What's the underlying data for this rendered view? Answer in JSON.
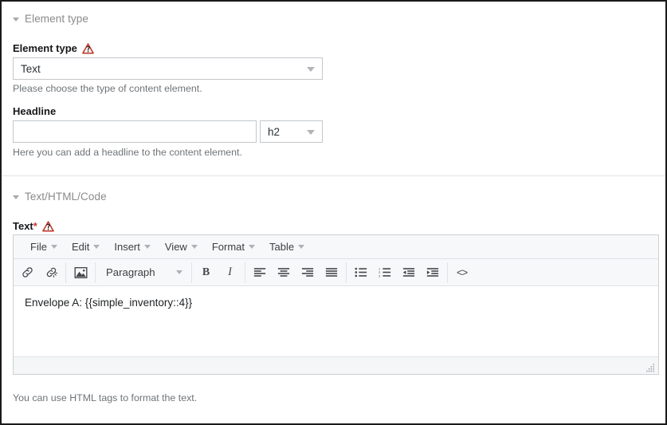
{
  "sections": [
    {
      "id": "element-type",
      "title": "Element type"
    },
    {
      "id": "text-html-code",
      "title": "Text/HTML/Code"
    }
  ],
  "element_type_field": {
    "label": "Element type",
    "warn_icon": "warning-triangle-icon",
    "value": "Text",
    "help": "Please choose the type of content element."
  },
  "headline_field": {
    "label": "Headline",
    "value": "",
    "placeholder": "",
    "tag_value": "h2",
    "help": "Here you can add a headline to the content element."
  },
  "text_field": {
    "label": "Text",
    "required_marker": "*",
    "warn_icon": "warning-triangle-icon",
    "help": "You can use HTML tags to format the text."
  },
  "editor": {
    "menubar": [
      {
        "label": "File",
        "icon": "chevron-down-icon"
      },
      {
        "label": "Edit",
        "icon": "chevron-down-icon"
      },
      {
        "label": "Insert",
        "icon": "chevron-down-icon"
      },
      {
        "label": "View",
        "icon": "chevron-down-icon"
      },
      {
        "label": "Format",
        "icon": "chevron-down-icon"
      },
      {
        "label": "Table",
        "icon": "chevron-down-icon"
      }
    ],
    "format_block": {
      "value": "Paragraph",
      "icon": "chevron-down-icon"
    },
    "toolbar_icons": [
      "link-icon",
      "unlink-icon",
      "image-icon",
      "bold-icon",
      "italic-icon",
      "align-left-icon",
      "align-center-icon",
      "align-right-icon",
      "align-justify-icon",
      "bullet-list-icon",
      "numbered-list-icon",
      "outdent-icon",
      "indent-icon",
      "source-code-icon"
    ],
    "bold_label": "B",
    "italic_label": "I",
    "source_code_label": "<>",
    "content": "Envelope A: {{simple_inventory::4}}",
    "statusbar_text": "",
    "resize_grip": "resize-grip-icon"
  },
  "colors": {
    "warning_red": "#c0392b",
    "required_star": "#c83737",
    "border": "#c3c7cb",
    "toolbar_bg": "#f7f8f9",
    "muted_text": "#6f7478",
    "section_title": "#8a8a8a"
  }
}
